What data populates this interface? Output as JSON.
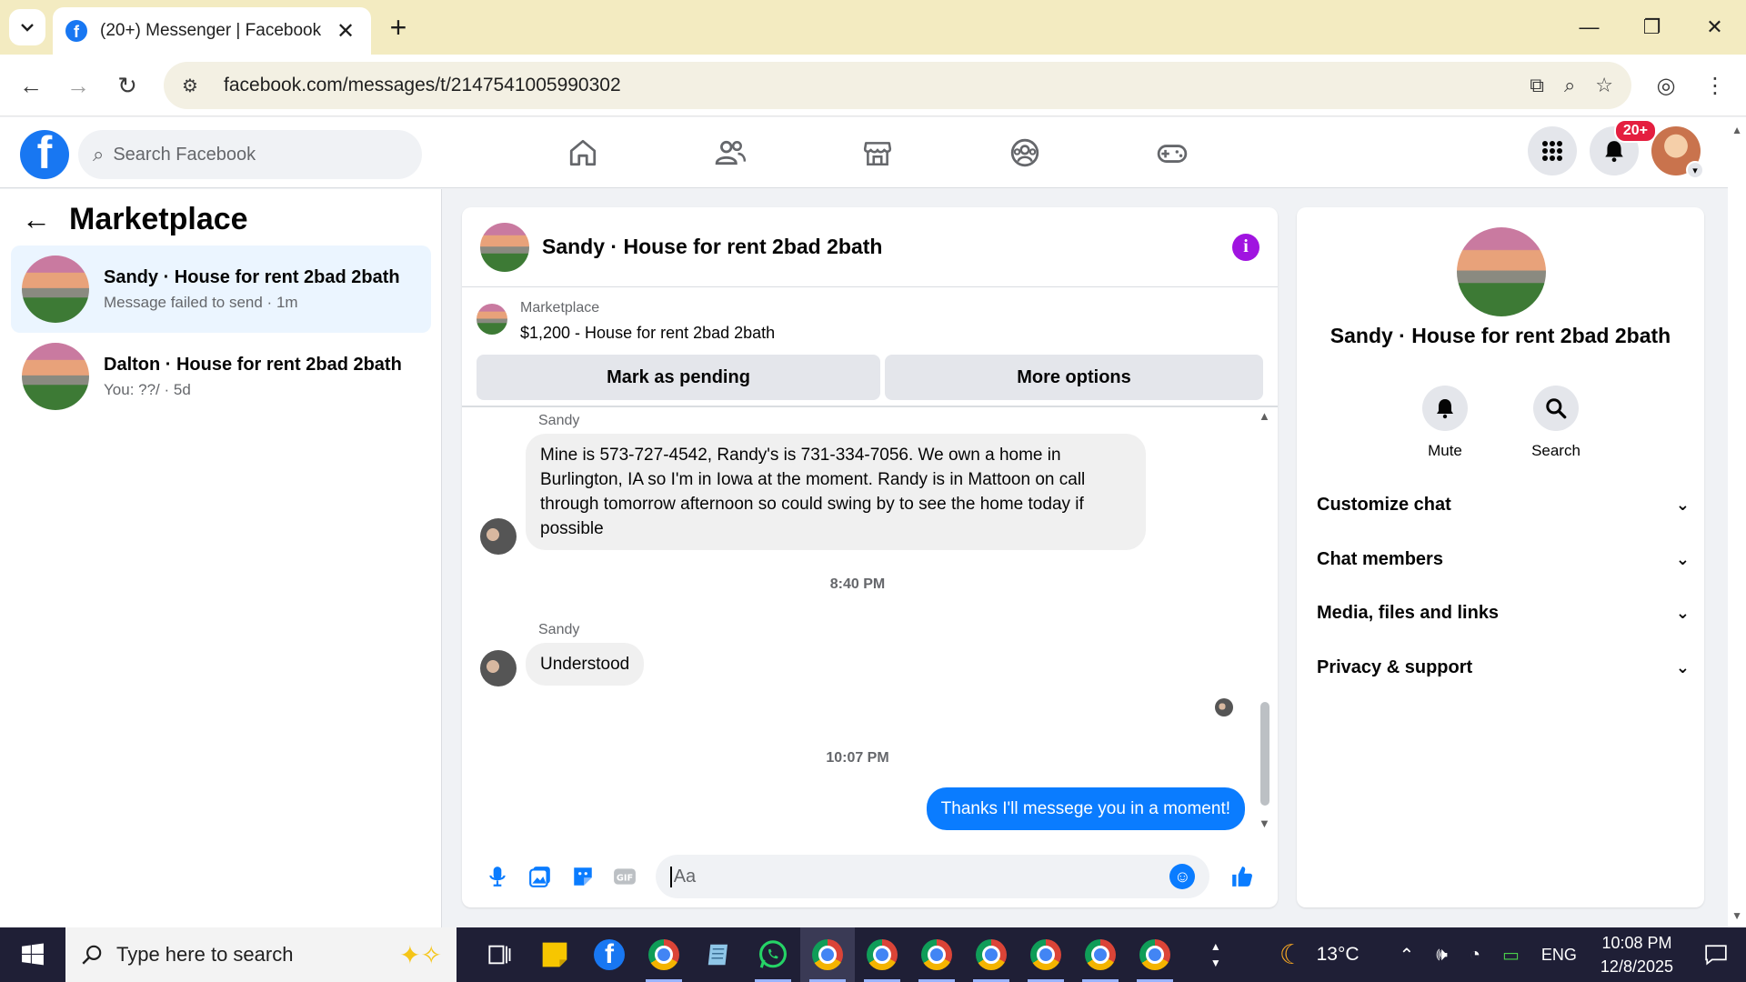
{
  "browser": {
    "tab_title": "(20+) Messenger | Facebook",
    "url": "facebook.com/messages/t/2147541005990302"
  },
  "fb_header": {
    "search_placeholder": "Search Facebook",
    "notification_count": "20+"
  },
  "left_panel": {
    "title": "Marketplace",
    "conversations": [
      {
        "name": "Sandy · House for rent 2bad 2bath",
        "subtitle": "Message failed to send · 1m"
      },
      {
        "name": "Dalton · House for rent 2bad 2bath",
        "subtitle": "You: ??/ · 5d"
      }
    ]
  },
  "chat": {
    "title": "Sandy · House for rent 2bad 2bath",
    "listing": {
      "category": "Marketplace",
      "title": "$1,200 - House for rent 2bad 2bath",
      "mark_pending_label": "Mark as pending",
      "more_options_label": "More options"
    },
    "messages": {
      "sender_1": "Sandy",
      "msg_1": "Mine is 573-727-4542, Randy's is 731-334-7056. We own a home in Burlington, IA so I'm in Iowa at the moment. Randy is in Mattoon on call through tomorrow afternoon so could swing by to see the home today if possible",
      "time_1": "8:40 PM",
      "sender_2": "Sandy",
      "msg_2": "Understood",
      "time_2": "10:07 PM",
      "msg_out": "Thanks I'll messege you in a moment!"
    },
    "composer_placeholder": "Aa"
  },
  "right_panel": {
    "name": "Sandy · House for rent 2bad 2bath",
    "mute_label": "Mute",
    "search_label": "Search",
    "sections": [
      "Customize chat",
      "Chat members",
      "Media, files and links",
      "Privacy & support"
    ]
  },
  "taskbar": {
    "search_placeholder": "Type here to search",
    "temperature": "13°C",
    "language": "ENG",
    "time": "10:08 PM",
    "date": "12/8/2025"
  },
  "colors": {
    "fb_blue": "#1877f2",
    "messenger_blue": "#0a7cff",
    "info_purple": "#a014e0",
    "badge_red": "#e41e3f"
  }
}
